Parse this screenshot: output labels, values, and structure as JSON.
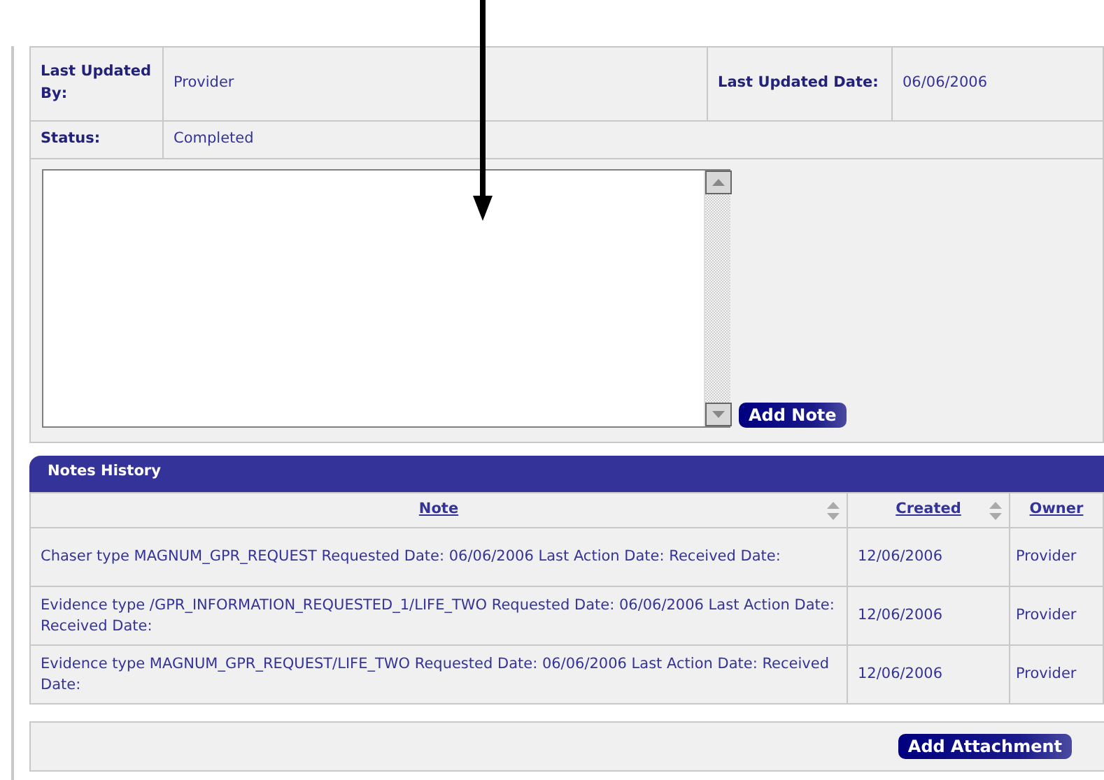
{
  "details": [
    {
      "label": "Last Updated By:",
      "value": "Provider",
      "label_2": "Last Updated Date:",
      "value_2": "06/06/2006"
    },
    {
      "label": "Status:",
      "value": "Completed"
    }
  ],
  "note_entry": {
    "button": "Add Note"
  },
  "notes_history": {
    "title": "Notes History",
    "columns": [
      {
        "label": "Note",
        "sortable": true
      },
      {
        "label": "Created",
        "sortable": true
      },
      {
        "label": "Owner",
        "sortable": false
      }
    ],
    "rows": [
      {
        "note": "Chaser type MAGNUM_GPR_REQUEST Requested Date: 06/06/2006 Last Action Date: Received Date:",
        "created": "12/06/2006",
        "owner": "Provider"
      },
      {
        "note": "Evidence type /GPR_INFORMATION_REQUESTED_1/LIFE_TWO Requested Date: 06/06/2006 Last Action Date: Received Date:",
        "created": "12/06/2006",
        "owner": "Provider"
      },
      {
        "note": "Evidence type MAGNUM_GPR_REQUEST/LIFE_TWO Requested Date: 06/06/2006 Last Action Date: Received Date:",
        "created": "12/06/2006",
        "owner": "Provider"
      }
    ]
  },
  "footer": {
    "button": "Add Attachment"
  }
}
